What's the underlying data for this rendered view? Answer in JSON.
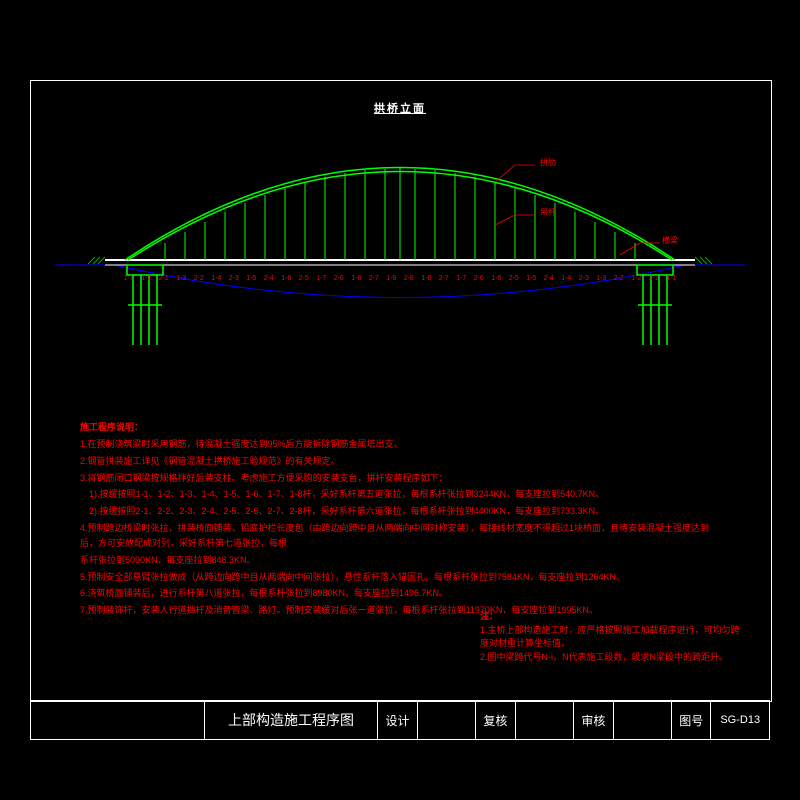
{
  "drawing": {
    "title": "拱桥立面",
    "elements": {
      "arch_label": "拱肋",
      "hanger_label": "吊杆",
      "beam_label": "横梁"
    },
    "hanger_numbers": [
      "1-1",
      "1-2",
      "2-1",
      "1-3",
      "2-2",
      "1-4",
      "2-3",
      "1-5",
      "2-4",
      "1-6",
      "2-5",
      "1-7",
      "2-6",
      "1-8",
      "2-7",
      "1-9",
      "2-8",
      "1-8",
      "2-7",
      "1-7",
      "2-6",
      "1-6",
      "2-5",
      "1-5",
      "2-4",
      "1-4",
      "2-3",
      "1-3",
      "2-2",
      "1-2",
      "2-1",
      "1-1"
    ]
  },
  "notes": {
    "header": "施工程序说明：",
    "items": [
      "1.在预制浇筑梁时采用钢筋，待混凝土强度达到95%后方能拆除钢筋金属塔出支。",
      "2.钢管拼装施工详见《钢管混凝土拱桥施工验规范》的有关规定。",
      "3.将钢筋闭口钢梁按规格拌好后装支柱。考虑施工方便采购的安装支台，拼杆安装程序如下：",
      "　1).按缓按照1-1、1-2、1-3、1-4、1-5、1-6、1-7、1-8杆，采好系杆第五道张拉，每根系杆张拉到3244KN，每支座拉到540.7KN。",
      "　2).按缓按照2-1、2-2、2-3、2-4、2-5、2-6、2-7、2-8杆，采好系杆第六道张拉，每根系杆张拉到4400KN，每支座拉到733.3KN。",
      "4.预制跨边桥梁时张拉，拼装桥面铺装，铅底护栏长度包（由跨边向跨中且从两端向中间对称安装），每接线材宽度不得超过1块桥面，且待安装混凝土强度达到后，方可安放配成对列，采好系杆第七道张拉，每根",
      "系杆张拉到5090KN，每支座拉到848.3KN。",
      "5.预制安全部悬臂张拉做成（从跨边向跨中且从两端向中间张拉），悬性系杆落入锚固孔。每根系杆张拉到7584KN，每支座拉到1264KN。",
      "6.浇筑桥面铺装后，进行系杆第八道张拉，每根系杆张拉到8980KN，每支座拉到1496.7KN。",
      "7.预制装饰杆，安装人行道挡杆及消音管梁、路灯。预制安装缓对后张一道张拉，每根系杆张拉到11970KN，每支座拉到1995KN。"
    ]
  },
  "side_note": {
    "header": "注：",
    "items": [
      "1.主桥上部构造施工时，应严格按照施工加载程序进行，可均匀跨度对材重计算坐标值。",
      "2.图中梁跨代号N-i，N代表施工段数，段求N梁段中的跨距升。"
    ]
  },
  "titleblock": {
    "drawing_title": "上部构造施工程序图",
    "fields": {
      "design_label": "设计",
      "check_label": "复核",
      "review_label": "审核",
      "sheet_label": "图号",
      "sheet_value": "SG-D13"
    }
  }
}
